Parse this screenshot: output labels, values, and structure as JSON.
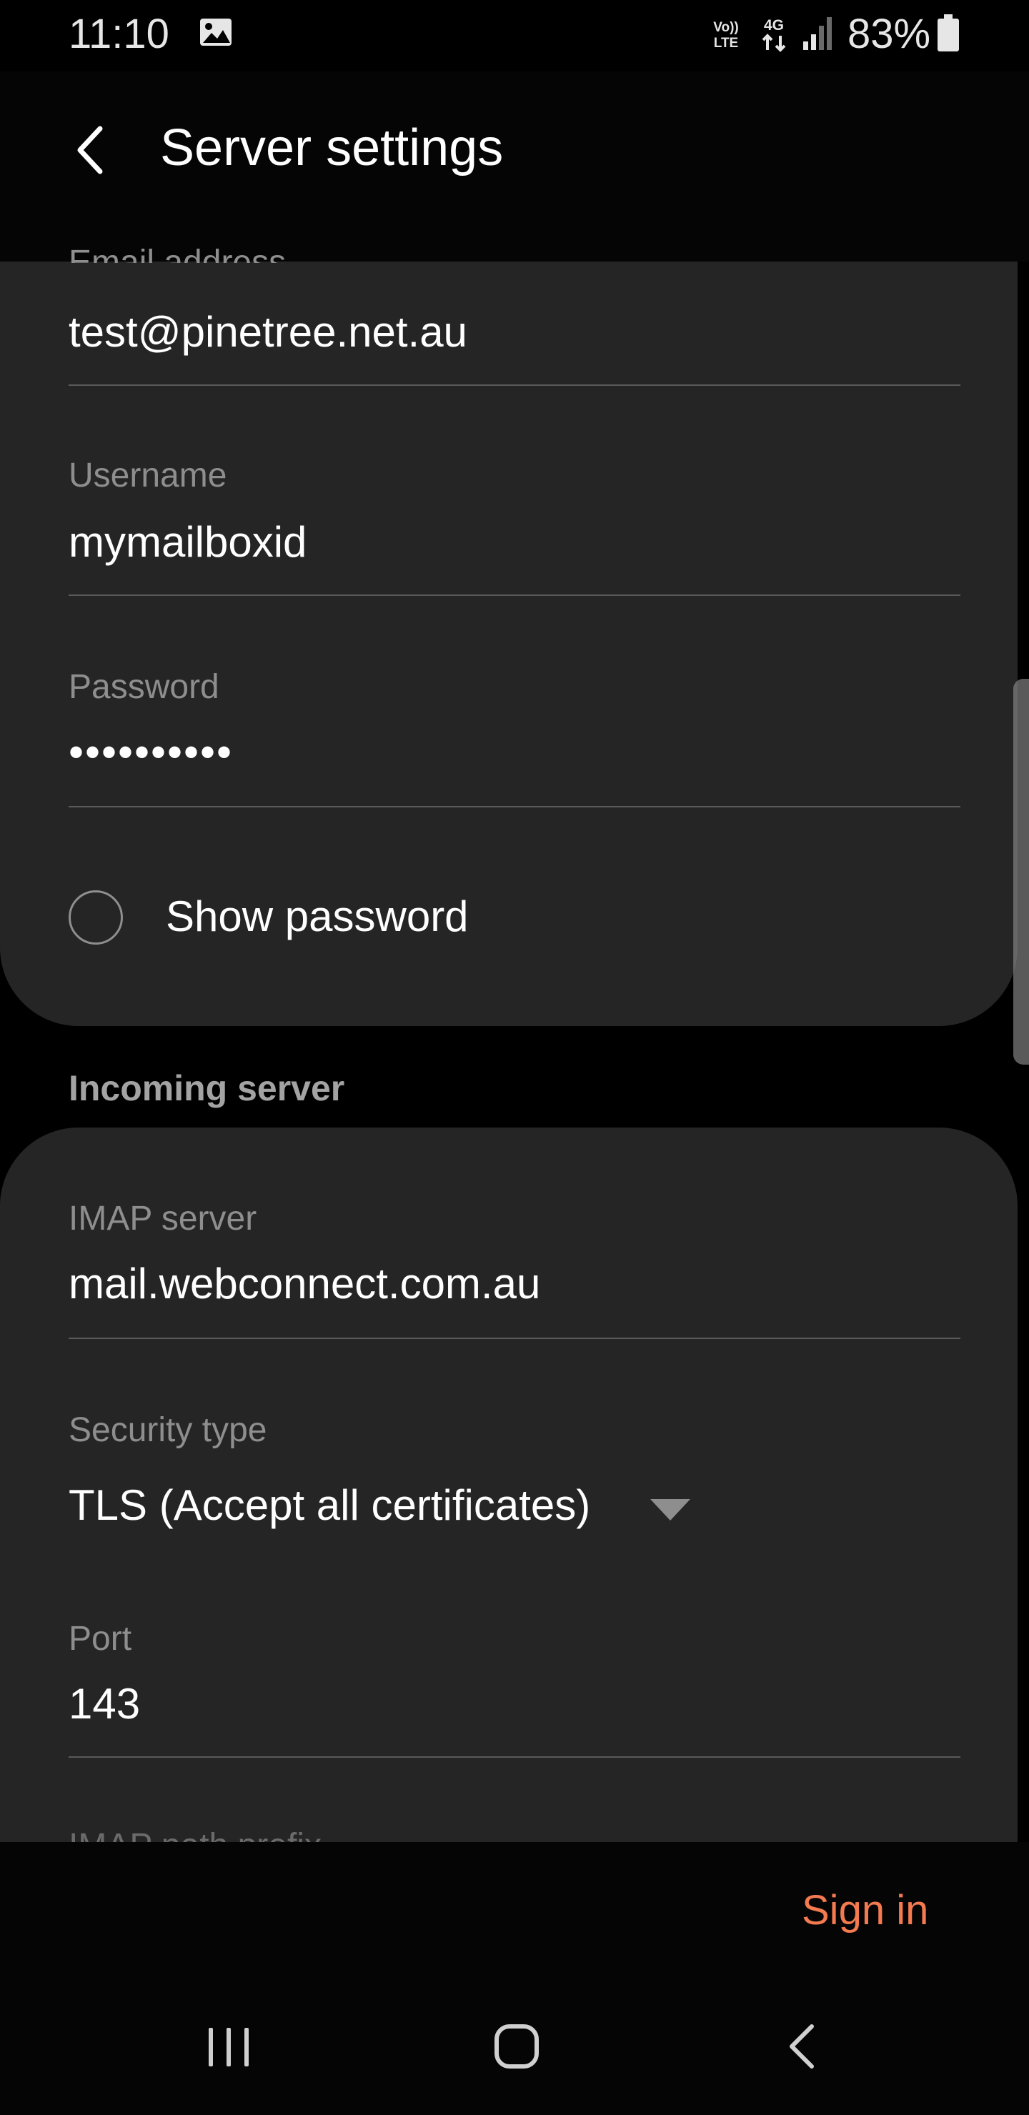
{
  "status_bar": {
    "time": "11:10",
    "battery_percent": "83%",
    "volte_top": "Vo))",
    "volte_bottom": "LTE",
    "network": "4G"
  },
  "app_bar": {
    "title": "Server settings"
  },
  "account": {
    "email_label": "Email address",
    "email_value": "test@pinetree.net.au",
    "username_label": "Username",
    "username_value": "mymailboxid",
    "password_label": "Password",
    "password_value": "••••••••••",
    "show_password_label": "Show password"
  },
  "incoming": {
    "section_title": "Incoming server",
    "imap_label": "IMAP server",
    "imap_value": "mail.webconnect.com.au",
    "security_label": "Security type",
    "security_value": "TLS (Accept all certificates)",
    "port_label": "Port",
    "port_value": "143",
    "next_label_partial": "IMAP path prefix"
  },
  "actions": {
    "sign_in": "Sign in"
  },
  "colors": {
    "accent": "#f47a50",
    "card_bg": "#252525",
    "background": "#000000"
  }
}
